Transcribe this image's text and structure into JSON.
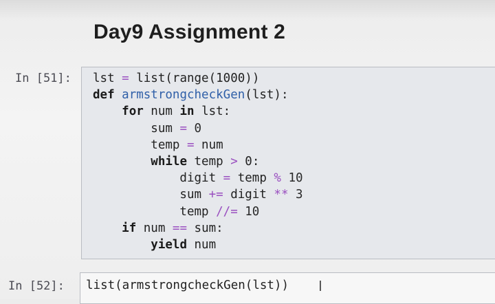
{
  "notebook": {
    "heading": "Day9 Assignment 2",
    "cells": [
      {
        "prompt": "In [51]:",
        "lines": [
          {
            "parts": [
              {
                "t": "lst ",
                "c": ""
              },
              {
                "t": "=",
                "c": "op"
              },
              {
                "t": " list(range(1000))",
                "c": ""
              }
            ]
          },
          {
            "parts": [
              {
                "t": "def ",
                "c": "kw"
              },
              {
                "t": "armstrongcheckGen",
                "c": "fn"
              },
              {
                "t": "(lst):",
                "c": ""
              }
            ]
          },
          {
            "parts": [
              {
                "t": "    ",
                "c": ""
              },
              {
                "t": "for",
                "c": "kw"
              },
              {
                "t": " num ",
                "c": ""
              },
              {
                "t": "in",
                "c": "kw"
              },
              {
                "t": " lst:",
                "c": ""
              }
            ]
          },
          {
            "parts": [
              {
                "t": "        sum ",
                "c": ""
              },
              {
                "t": "=",
                "c": "op"
              },
              {
                "t": " 0",
                "c": "num"
              }
            ]
          },
          {
            "parts": [
              {
                "t": "        temp ",
                "c": ""
              },
              {
                "t": "=",
                "c": "op"
              },
              {
                "t": " num",
                "c": ""
              }
            ]
          },
          {
            "parts": [
              {
                "t": "        ",
                "c": ""
              },
              {
                "t": "while",
                "c": "kw"
              },
              {
                "t": " temp ",
                "c": ""
              },
              {
                "t": ">",
                "c": "op"
              },
              {
                "t": " 0:",
                "c": ""
              }
            ]
          },
          {
            "parts": [
              {
                "t": "            digit ",
                "c": ""
              },
              {
                "t": "=",
                "c": "op"
              },
              {
                "t": " temp ",
                "c": ""
              },
              {
                "t": "%",
                "c": "op"
              },
              {
                "t": " 10",
                "c": "num"
              }
            ]
          },
          {
            "parts": [
              {
                "t": "            sum ",
                "c": ""
              },
              {
                "t": "+=",
                "c": "op"
              },
              {
                "t": " digit ",
                "c": ""
              },
              {
                "t": "**",
                "c": "op"
              },
              {
                "t": " 3",
                "c": "num"
              }
            ]
          },
          {
            "parts": [
              {
                "t": "            temp ",
                "c": ""
              },
              {
                "t": "//=",
                "c": "op"
              },
              {
                "t": " 10",
                "c": "num"
              }
            ]
          },
          {
            "parts": [
              {
                "t": "    ",
                "c": ""
              },
              {
                "t": "if",
                "c": "kw"
              },
              {
                "t": " num ",
                "c": ""
              },
              {
                "t": "==",
                "c": "op"
              },
              {
                "t": " sum:",
                "c": ""
              }
            ]
          },
          {
            "parts": [
              {
                "t": "        ",
                "c": ""
              },
              {
                "t": "yield",
                "c": "kw"
              },
              {
                "t": " num",
                "c": ""
              }
            ]
          }
        ]
      },
      {
        "prompt": "In [52]:",
        "lines": [
          {
            "parts": [
              {
                "t": "list(armstrongcheckGen(lst))",
                "c": ""
              }
            ]
          }
        ]
      }
    ]
  },
  "cursor_glyph": "I"
}
